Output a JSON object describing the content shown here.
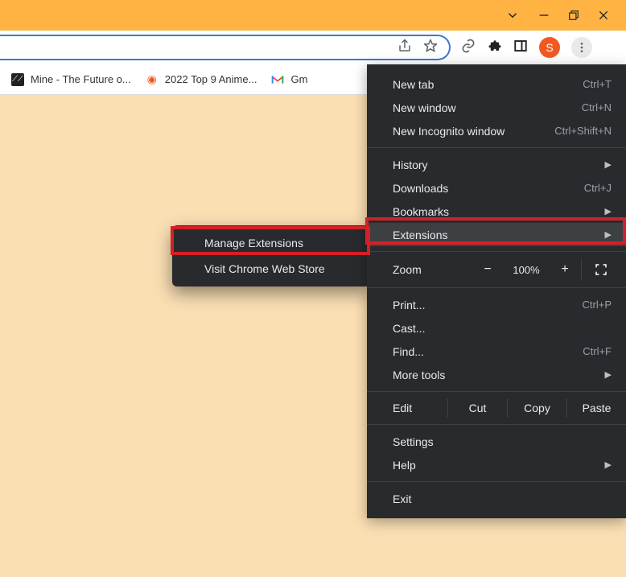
{
  "window_controls": {
    "dropdown": "⌄",
    "minimize": "−",
    "restore": "❐",
    "close": "✕"
  },
  "omnibox": {
    "share_icon": "share-icon",
    "star_icon": "star-icon"
  },
  "toolbar": {
    "link_icon": "link-icon",
    "extensions_icon": "puzzle-icon",
    "sidepanel_icon": "panel-icon",
    "avatar_letter": "S",
    "menu_icon": "⋮"
  },
  "bookmarks": [
    {
      "icon": "mine",
      "label": "Mine - The Future o..."
    },
    {
      "icon": "fire",
      "label": "2022 Top 9 Anime..."
    },
    {
      "icon": "gmail",
      "label": "Gm"
    }
  ],
  "menu": {
    "new_tab": {
      "label": "New tab",
      "shortcut": "Ctrl+T"
    },
    "new_window": {
      "label": "New window",
      "shortcut": "Ctrl+N"
    },
    "new_incognito": {
      "label": "New Incognito window",
      "shortcut": "Ctrl+Shift+N"
    },
    "history": {
      "label": "History"
    },
    "downloads": {
      "label": "Downloads",
      "shortcut": "Ctrl+J"
    },
    "bookmarks": {
      "label": "Bookmarks"
    },
    "extensions": {
      "label": "Extensions"
    },
    "zoom": {
      "label": "Zoom",
      "minus": "−",
      "value": "100%",
      "plus": "+"
    },
    "print": {
      "label": "Print...",
      "shortcut": "Ctrl+P"
    },
    "cast": {
      "label": "Cast..."
    },
    "find": {
      "label": "Find...",
      "shortcut": "Ctrl+F"
    },
    "more_tools": {
      "label": "More tools"
    },
    "edit": {
      "label": "Edit",
      "cut": "Cut",
      "copy": "Copy",
      "paste": "Paste"
    },
    "settings": {
      "label": "Settings"
    },
    "help": {
      "label": "Help"
    },
    "exit": {
      "label": "Exit"
    }
  },
  "submenu": {
    "manage": "Manage Extensions",
    "webstore": "Visit Chrome Web Store"
  },
  "colors": {
    "highlight": "#d41f26"
  }
}
